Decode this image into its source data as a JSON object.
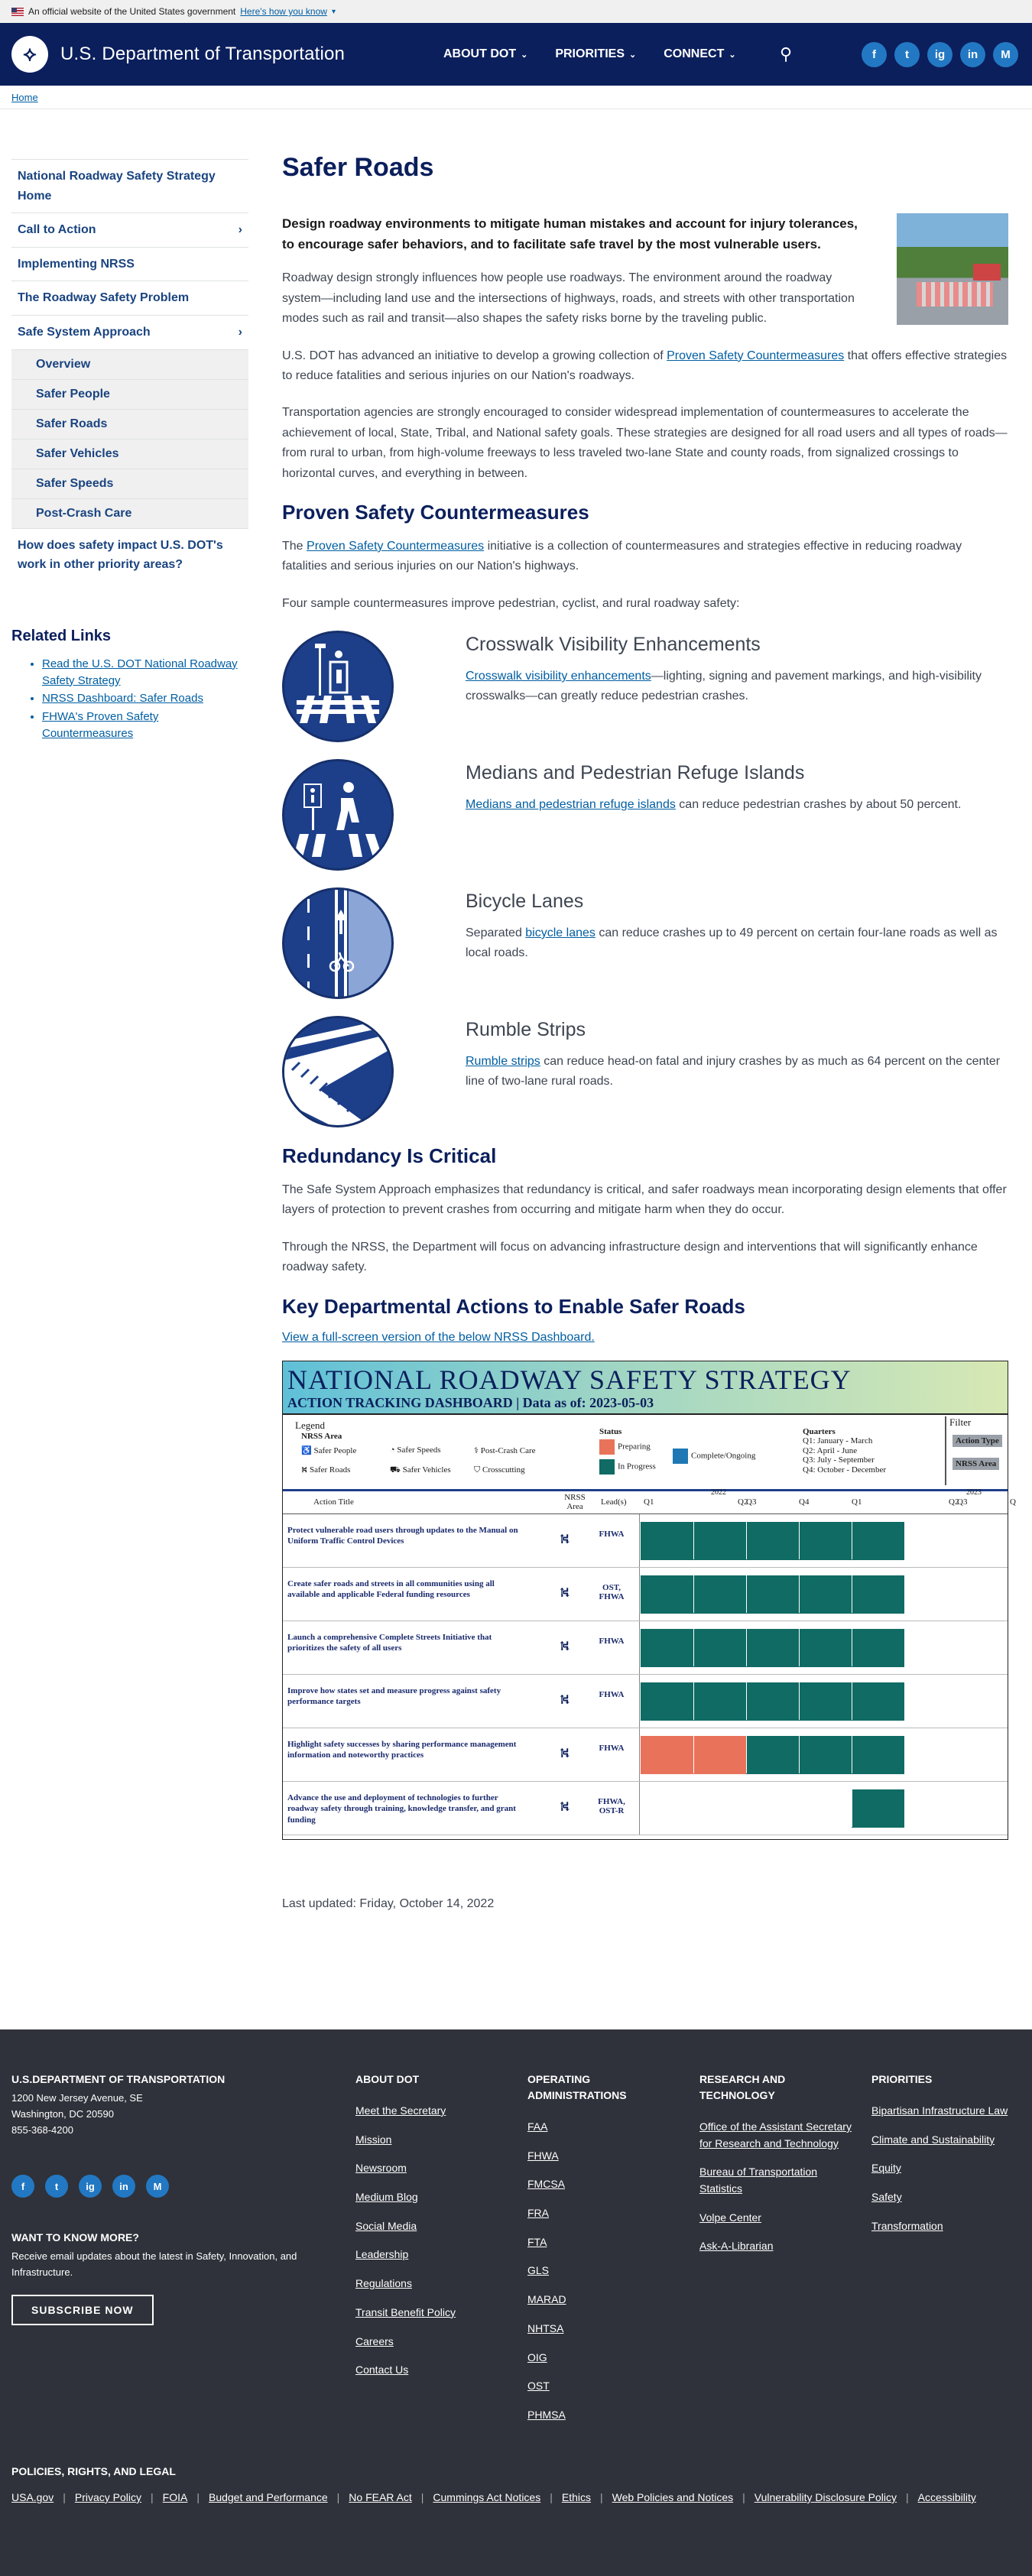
{
  "gov_banner": {
    "text": "An official website of the United States government",
    "link": "Here's how you know"
  },
  "header": {
    "title": "U.S. Department of Transportation",
    "nav": [
      "ABOUT DOT",
      "PRIORITIES",
      "CONNECT"
    ],
    "social": [
      "f",
      "t",
      "ig",
      "in",
      "M"
    ]
  },
  "breadcrumb": "Home",
  "sidebar": {
    "items": [
      {
        "label": "National Roadway Safety Strategy Home"
      },
      {
        "label": "Call to Action",
        "chevron": "›"
      },
      {
        "label": "Implementing NRSS"
      },
      {
        "label": "The Roadway Safety Problem"
      },
      {
        "label": "Safe System Approach",
        "chevron": "›"
      }
    ],
    "subitems": [
      "Overview",
      "Safer People",
      "Safer Roads",
      "Safer Vehicles",
      "Safer Speeds",
      "Post-Crash Care"
    ],
    "last": "How does safety impact U.S. DOT's work in other priority areas?",
    "related_heading": "Related Links",
    "related": [
      "Read the U.S. DOT National Roadway Safety Strategy",
      "NRSS Dashboard: Safer Roads",
      "FHWA's Proven Safety Countermeasures"
    ]
  },
  "main": {
    "title": "Safer Roads",
    "lead": "Design roadway environments to mitigate human mistakes and account for injury tolerances, to encourage safer behaviors, and to facilitate safe travel by the most vulnerable users.",
    "p1": "Roadway design strongly influences how people use roadways. The environment around the roadway system—including land use and the intersections of highways, roads, and streets with other transportation modes such as rail and transit—also shapes the safety risks borne by the traveling public.",
    "p2_a": "U.S. DOT has advanced an initiative to develop a growing collection of ",
    "p2_link": "Proven Safety Countermeasures",
    "p2_b": " that offers effective strategies to reduce fatalities and serious injuries on our Nation's roadways.",
    "p3": "Transportation agencies are strongly encouraged to consider widespread implementation of countermeasures to accelerate the achievement of local, State, Tribal, and National safety goals. These strategies are designed for all road users and all types of roads—from rural to urban, from high-volume freeways to less traveled two-lane State and county roads, from signalized crossings to horizontal curves, and everything in between.",
    "h_psc": "Proven Safety Countermeasures",
    "psc_a": "The ",
    "psc_link": "Proven Safety Countermeasures",
    "psc_b": " initiative is a collection of countermeasures and strategies effective in reducing roadway fatalities and serious injuries on our Nation's highways.",
    "psc_four": "Four sample countermeasures improve pedestrian, cyclist, and rural roadway safety:",
    "countermeasures": [
      {
        "title": "Crosswalk Visibility Enhancements",
        "link": "Crosswalk visibility enhancements",
        "rest": "—lighting, signing and pavement markings, and high-visibility crosswalks—can greatly reduce pedestrian crashes.",
        "icon": "crosswalk-icon"
      },
      {
        "title": "Medians and Pedestrian Refuge Islands",
        "link": "Medians and pedestrian refuge islands",
        "rest": " can reduce pedestrian crashes by about 50 percent.",
        "icon": "refuge-island-icon"
      },
      {
        "title": "Bicycle Lanes",
        "pre": "Separated ",
        "link": "bicycle lanes",
        "rest": " can reduce crashes up to 49 percent on certain four-lane roads as well as local roads.",
        "icon": "bicycle-lane-icon"
      },
      {
        "title": "Rumble Strips",
        "link": "Rumble strips",
        "rest": " can reduce head-on fatal and injury crashes by as much as 64 percent on the center line of two-lane rural roads.",
        "icon": "rumble-strip-icon"
      }
    ],
    "h_red": "Redundancy Is Critical",
    "red1": "The Safe System Approach emphasizes that redundancy is critical, and safer roadways mean incorporating design elements that offer layers of protection to prevent crashes from occurring and mitigate harm when they do occur.",
    "red2": "Through the NRSS, the Department will focus on advancing infrastructure design and interventions that will significantly enhance roadway safety.",
    "h_key": "Key Departmental Actions to Enable Safer Roads",
    "dash_link": "View a full-screen version of the below NRSS Dashboard.",
    "updated": "Last updated: Friday, October 14, 2022"
  },
  "dashboard": {
    "title": "NATIONAL ROADWAY SAFETY STRATEGY",
    "subtitle": "ACTION TRACKING DASHBOARD | Data as of: 2023-05-03",
    "legend_label": "Legend",
    "nrss_area": "NRSS Area",
    "areas": [
      "Safer People",
      "Safer Speeds",
      "Post-Crash Care",
      "Safer Roads",
      "Safer Vehicles",
      "Crosscutting"
    ],
    "status_label": "Status",
    "statuses": [
      {
        "label": "Preparing",
        "color": "#e8735a"
      },
      {
        "label": "Complete/Ongoing",
        "color": "#1f78b4"
      },
      {
        "label": "In Progress",
        "color": "#0f6b64"
      }
    ],
    "quarters_label": "Quarters",
    "quarters": [
      "Q1: January - March",
      "Q2: April - June",
      "Q3: July - September",
      "Q4: October - December"
    ],
    "filter_label": "Filter",
    "filters": [
      "Action Type",
      "NRSS Area"
    ],
    "col_action": "Action Title",
    "col_area": "NRSS Area",
    "col_lead": "Lead(s)",
    "year_labels": [
      "2022",
      "2023"
    ],
    "q_labels": [
      "Q1",
      "Q2",
      "Q3",
      "Q4",
      "Q1",
      "Q2",
      "Q3",
      "Q"
    ],
    "rows": [
      {
        "title": "Protect vulnerable road users through updates to the Manual on Uniform Traffic Control Devices",
        "lead": "FHWA",
        "prep": 0,
        "prog": 5
      },
      {
        "title": "Create safer roads and streets in all communities using all available and applicable Federal funding resources",
        "lead": "OST, FHWA",
        "prep": 0,
        "prog": 5
      },
      {
        "title": "Launch a comprehensive Complete Streets Initiative that prioritizes the safety of all users",
        "lead": "FHWA",
        "prep": 0,
        "prog": 5
      },
      {
        "title": "Improve how states set and measure progress against safety performance targets",
        "lead": "FHWA",
        "prep": 0,
        "prog": 5
      },
      {
        "title": "Highlight safety successes by sharing performance management information and noteworthy practices",
        "lead": "FHWA",
        "prep": 2,
        "prog": 3
      },
      {
        "title": "Advance the use and deployment of technologies to further roadway safety through training, knowledge transfer, and grant funding",
        "lead": "FHWA, OST-R",
        "prep": 0,
        "prog": 1,
        "start": 4
      }
    ]
  },
  "footer": {
    "org": "U.S.DEPARTMENT OF TRANSPORTATION",
    "addr1": "1200 New Jersey Avenue, SE",
    "addr2": "Washington, DC 20590",
    "phone": "855-368-4200",
    "want": "WANT TO KNOW MORE?",
    "want_text": "Receive email updates about the latest in Safety, Innovation, and Infrastructure.",
    "subscribe": "SUBSCRIBE NOW",
    "about_h": "ABOUT DOT",
    "about": [
      "Meet the Secretary",
      "Mission",
      "Newsroom",
      "Medium Blog",
      "Social Media",
      "Leadership",
      "Regulations",
      "Transit Benefit Policy",
      "Careers",
      "Contact Us"
    ],
    "op_h": "OPERATING ADMINISTRATIONS",
    "op": [
      "FAA",
      "FHWA",
      "FMCSA",
      "FRA",
      "FTA",
      "GLS",
      "MARAD",
      "NHTSA",
      "OIG",
      "OST",
      "PHMSA"
    ],
    "rt_h": "RESEARCH AND TECHNOLOGY",
    "rt": [
      "Office of the Assistant Secretary for Research and Technology",
      "Bureau of Transportation Statistics",
      "Volpe Center",
      "Ask-A-Librarian"
    ],
    "pr_h": "PRIORITIES",
    "pr": [
      "Bipartisan Infrastructure Law",
      "Climate and Sustainability",
      "Equity",
      "Safety",
      "Transformation"
    ],
    "policy_h": "POLICIES, RIGHTS, AND LEGAL",
    "policy": [
      "USA.gov",
      "Privacy Policy",
      "FOIA",
      "Budget and Performance",
      "No FEAR Act",
      "Cummings Act Notices",
      "Ethics",
      "Web Policies and Notices",
      "Vulnerability Disclosure Policy",
      "Accessibility"
    ]
  }
}
